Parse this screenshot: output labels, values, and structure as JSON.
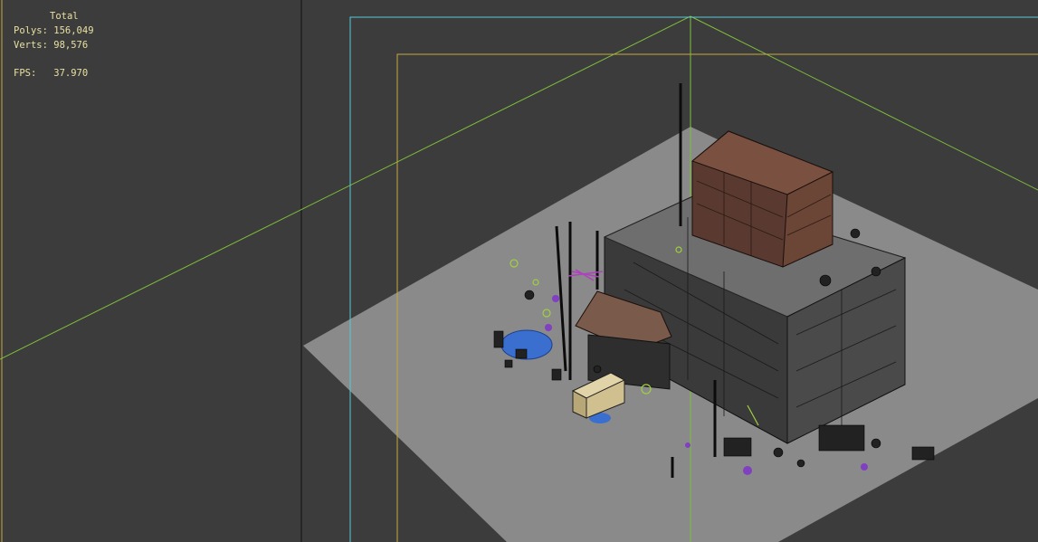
{
  "viewport": {
    "stats": {
      "total_label": "Total",
      "polys_label": "Polys:",
      "polys_value": "156,049",
      "verts_label": "Verts:",
      "verts_value": "98,576",
      "fps_label": "FPS:",
      "fps_value": "37.970"
    },
    "colors": {
      "background": "#3c3c3c",
      "ground_plane": "#8a8a8a",
      "grid_line": "#8dc63f",
      "safe_frame_outer": "#59c8d8",
      "safe_frame_inner": "#c8a840",
      "stats_text": "#e8e0a0"
    }
  }
}
